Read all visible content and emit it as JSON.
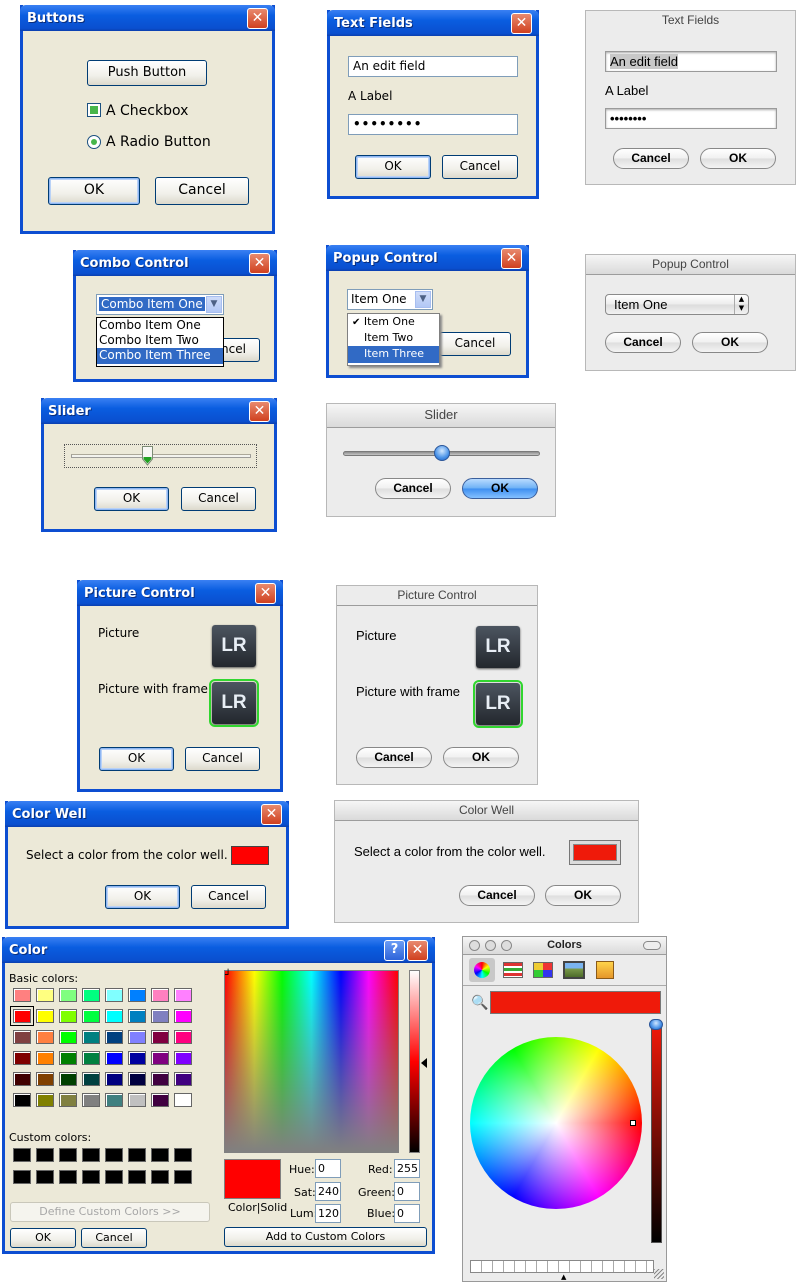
{
  "buttons_xp": {
    "title": "Buttons",
    "push": "Push Button",
    "checkbox": "A Checkbox",
    "radio": "A Radio Button",
    "ok": "OK",
    "cancel": "Cancel"
  },
  "textfields_xp": {
    "title": "Text Fields",
    "edit_value": "An edit field",
    "label": "A Label",
    "password": "••••••••",
    "ok": "OK",
    "cancel": "Cancel"
  },
  "textfields_mac": {
    "title": "Text Fields",
    "edit_value": "An edit field",
    "label": "A Label",
    "password": "••••••••",
    "cancel": "Cancel",
    "ok": "OK"
  },
  "combo_xp": {
    "title": "Combo Control",
    "selected": "Combo Item One",
    "items": [
      "Combo Item One",
      "Combo Item Two",
      "Combo Item Three"
    ],
    "cancel_partial": "ncel"
  },
  "popup_xp": {
    "title": "Popup Control",
    "selected": "Item One",
    "items": [
      "Item One",
      "Item Two",
      "Item Three"
    ],
    "cancel": "Cancel"
  },
  "popup_mac": {
    "title": "Popup Control",
    "selected": "Item One",
    "cancel": "Cancel",
    "ok": "OK"
  },
  "slider_xp": {
    "title": "Slider",
    "value": 0.42,
    "ok": "OK",
    "cancel": "Cancel"
  },
  "slider_mac": {
    "title": "Slider",
    "value": 0.5,
    "cancel": "Cancel",
    "ok": "OK"
  },
  "picture_xp": {
    "title": "Picture Control",
    "picture": "Picture",
    "picture_frame": "Picture with frame",
    "logo": "LR",
    "ok": "OK",
    "cancel": "Cancel"
  },
  "picture_mac": {
    "title": "Picture Control",
    "picture": "Picture",
    "picture_frame": "Picture with frame",
    "logo": "LR",
    "cancel": "Cancel",
    "ok": "OK"
  },
  "colorwell_xp": {
    "title": "Color Well",
    "prompt": "Select a color from the color well.",
    "color": "#ff0000",
    "ok": "OK",
    "cancel": "Cancel"
  },
  "colorwell_mac": {
    "title": "Color Well",
    "prompt": "Select a color from the color well.",
    "color": "#ef1a0a",
    "cancel": "Cancel",
    "ok": "OK"
  },
  "color_xp": {
    "title": "Color",
    "help": "?",
    "basic_label": "Basic colors:",
    "custom_label": "Custom colors:",
    "define_btn": "Define Custom Colors >>",
    "ok": "OK",
    "cancel": "Cancel",
    "add_btn": "Add to Custom Colors",
    "colorsolid": "Color|Solid",
    "hue_label": "Hue:",
    "hue": "0",
    "sat_label": "Sat:",
    "sat": "240",
    "lum_label": "Lum:",
    "lum": "120",
    "red_label": "Red:",
    "red": "255",
    "green_label": "Green:",
    "green": "0",
    "blue_label": "Blue:",
    "blue": "0",
    "basic_colors": [
      "#ff8080",
      "#ffff80",
      "#80ff80",
      "#00ff80",
      "#80ffff",
      "#0080ff",
      "#ff80c0",
      "#ff80ff",
      "#ff0000",
      "#ffff00",
      "#80ff00",
      "#00ff40",
      "#00ffff",
      "#0080c0",
      "#8080c0",
      "#ff00ff",
      "#804040",
      "#ff8040",
      "#00ff00",
      "#008080",
      "#004080",
      "#8080ff",
      "#800040",
      "#ff0080",
      "#800000",
      "#ff8000",
      "#008000",
      "#008040",
      "#0000ff",
      "#0000a0",
      "#800080",
      "#8000ff",
      "#400000",
      "#804000",
      "#004000",
      "#004040",
      "#000080",
      "#000040",
      "#400040",
      "#400080",
      "#000000",
      "#808000",
      "#808040",
      "#808080",
      "#408080",
      "#c0c0c0",
      "#400040",
      "#ffffff"
    ],
    "selected_color": "#ff0000"
  },
  "colors_mac": {
    "title": "Colors",
    "color": "#ef1a0a"
  }
}
